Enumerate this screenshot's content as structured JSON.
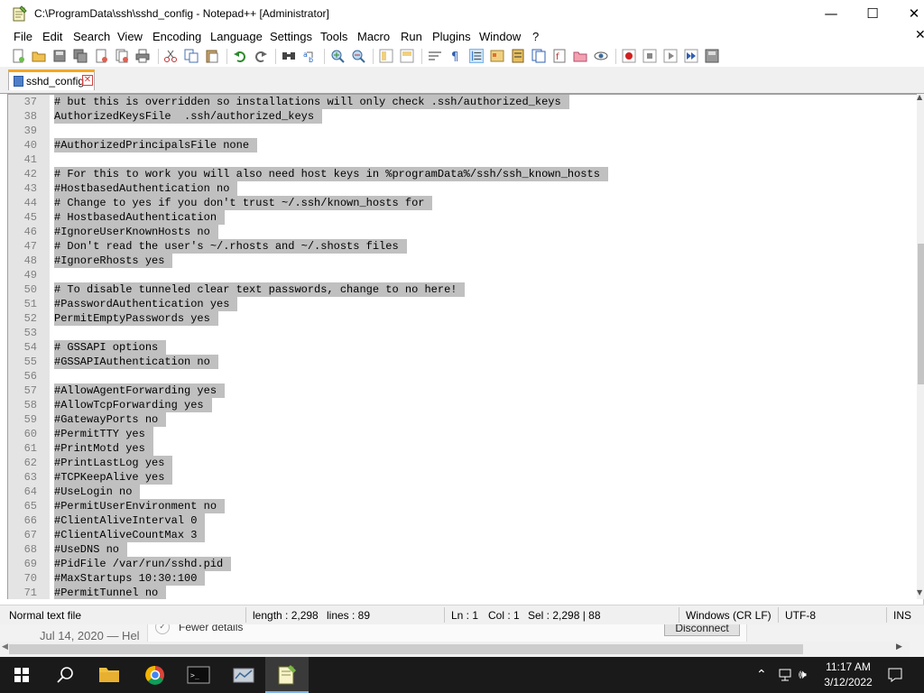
{
  "window": {
    "title": "C:\\ProgramData\\ssh\\sshd_config - Notepad++ [Administrator]",
    "minimize_glyph": "—",
    "maximize_glyph": "☐",
    "close_glyph": "✕"
  },
  "menu": [
    "File",
    "Edit",
    "Search",
    "View",
    "Encoding",
    "Language",
    "Settings",
    "Tools",
    "Macro",
    "Run",
    "Plugins",
    "Window",
    "?"
  ],
  "menu_close_glyph": "✕",
  "tab": {
    "label": "sshd_config",
    "close_glyph": "✕"
  },
  "editor": {
    "lines": [
      {
        "n": "37",
        "text": "# but this is overridden so installations will only check .ssh/authorized_keys"
      },
      {
        "n": "38",
        "text": "AuthorizedKeysFile  .ssh/authorized_keys"
      },
      {
        "n": "39",
        "text": ""
      },
      {
        "n": "40",
        "text": "#AuthorizedPrincipalsFile none"
      },
      {
        "n": "41",
        "text": ""
      },
      {
        "n": "42",
        "text": "# For this to work you will also need host keys in %programData%/ssh/ssh_known_hosts"
      },
      {
        "n": "43",
        "text": "#HostbasedAuthentication no"
      },
      {
        "n": "44",
        "text": "# Change to yes if you don't trust ~/.ssh/known_hosts for"
      },
      {
        "n": "45",
        "text": "# HostbasedAuthentication"
      },
      {
        "n": "46",
        "text": "#IgnoreUserKnownHosts no"
      },
      {
        "n": "47",
        "text": "# Don't read the user's ~/.rhosts and ~/.shosts files"
      },
      {
        "n": "48",
        "text": "#IgnoreRhosts yes"
      },
      {
        "n": "49",
        "text": ""
      },
      {
        "n": "50",
        "text": "# To disable tunneled clear text passwords, change to no here!"
      },
      {
        "n": "51",
        "text": "#PasswordAuthentication yes"
      },
      {
        "n": "52",
        "text": "PermitEmptyPasswords yes"
      },
      {
        "n": "53",
        "text": ""
      },
      {
        "n": "54",
        "text": "# GSSAPI options"
      },
      {
        "n": "55",
        "text": "#GSSAPIAuthentication no"
      },
      {
        "n": "56",
        "text": ""
      },
      {
        "n": "57",
        "text": "#AllowAgentForwarding yes"
      },
      {
        "n": "58",
        "text": "#AllowTcpForwarding yes"
      },
      {
        "n": "59",
        "text": "#GatewayPorts no"
      },
      {
        "n": "60",
        "text": "#PermitTTY yes"
      },
      {
        "n": "61",
        "text": "#PrintMotd yes"
      },
      {
        "n": "62",
        "text": "#PrintLastLog yes"
      },
      {
        "n": "63",
        "text": "#TCPKeepAlive yes"
      },
      {
        "n": "64",
        "text": "#UseLogin no"
      },
      {
        "n": "65",
        "text": "#PermitUserEnvironment no"
      },
      {
        "n": "66",
        "text": "#ClientAliveInterval 0"
      },
      {
        "n": "67",
        "text": "#ClientAliveCountMax 3"
      },
      {
        "n": "68",
        "text": "#UseDNS no"
      },
      {
        "n": "69",
        "text": "#PidFile /var/run/sshd.pid"
      },
      {
        "n": "70",
        "text": "#MaxStartups 10:30:100"
      },
      {
        "n": "71",
        "text": "#PermitTunnel no"
      }
    ],
    "selection_color": "#c0c0c0"
  },
  "status": {
    "file_type": "Normal text file",
    "length": "length : 2,298",
    "lines": "lines : 89",
    "ln": "Ln : 1",
    "col": "Col : 1",
    "sel": "Sel : 2,298 | 88",
    "eol": "Windows (CR LF)",
    "encoding": "UTF-8",
    "mode": "INS"
  },
  "background": {
    "date": "Jul 14, 2020 — Hel",
    "fewer_details": "Fewer details",
    "disconnect": "Disconnect"
  },
  "taskbar": {
    "time": "11:17 AM",
    "date": "3/12/2022",
    "icons": [
      "start-icon",
      "search-icon",
      "file-explorer-icon",
      "chrome-icon",
      "terminal-icon",
      "server-manager-icon",
      "notepad-plus-plus-icon"
    ],
    "tray_icons": [
      "chevron-up-icon",
      "network-icon",
      "volume-icon",
      "notification-icon"
    ]
  },
  "colors": {
    "tab_accent": "#f5a623",
    "gutter": "#e4e4e4",
    "taskbar": "#1a1a1a"
  }
}
